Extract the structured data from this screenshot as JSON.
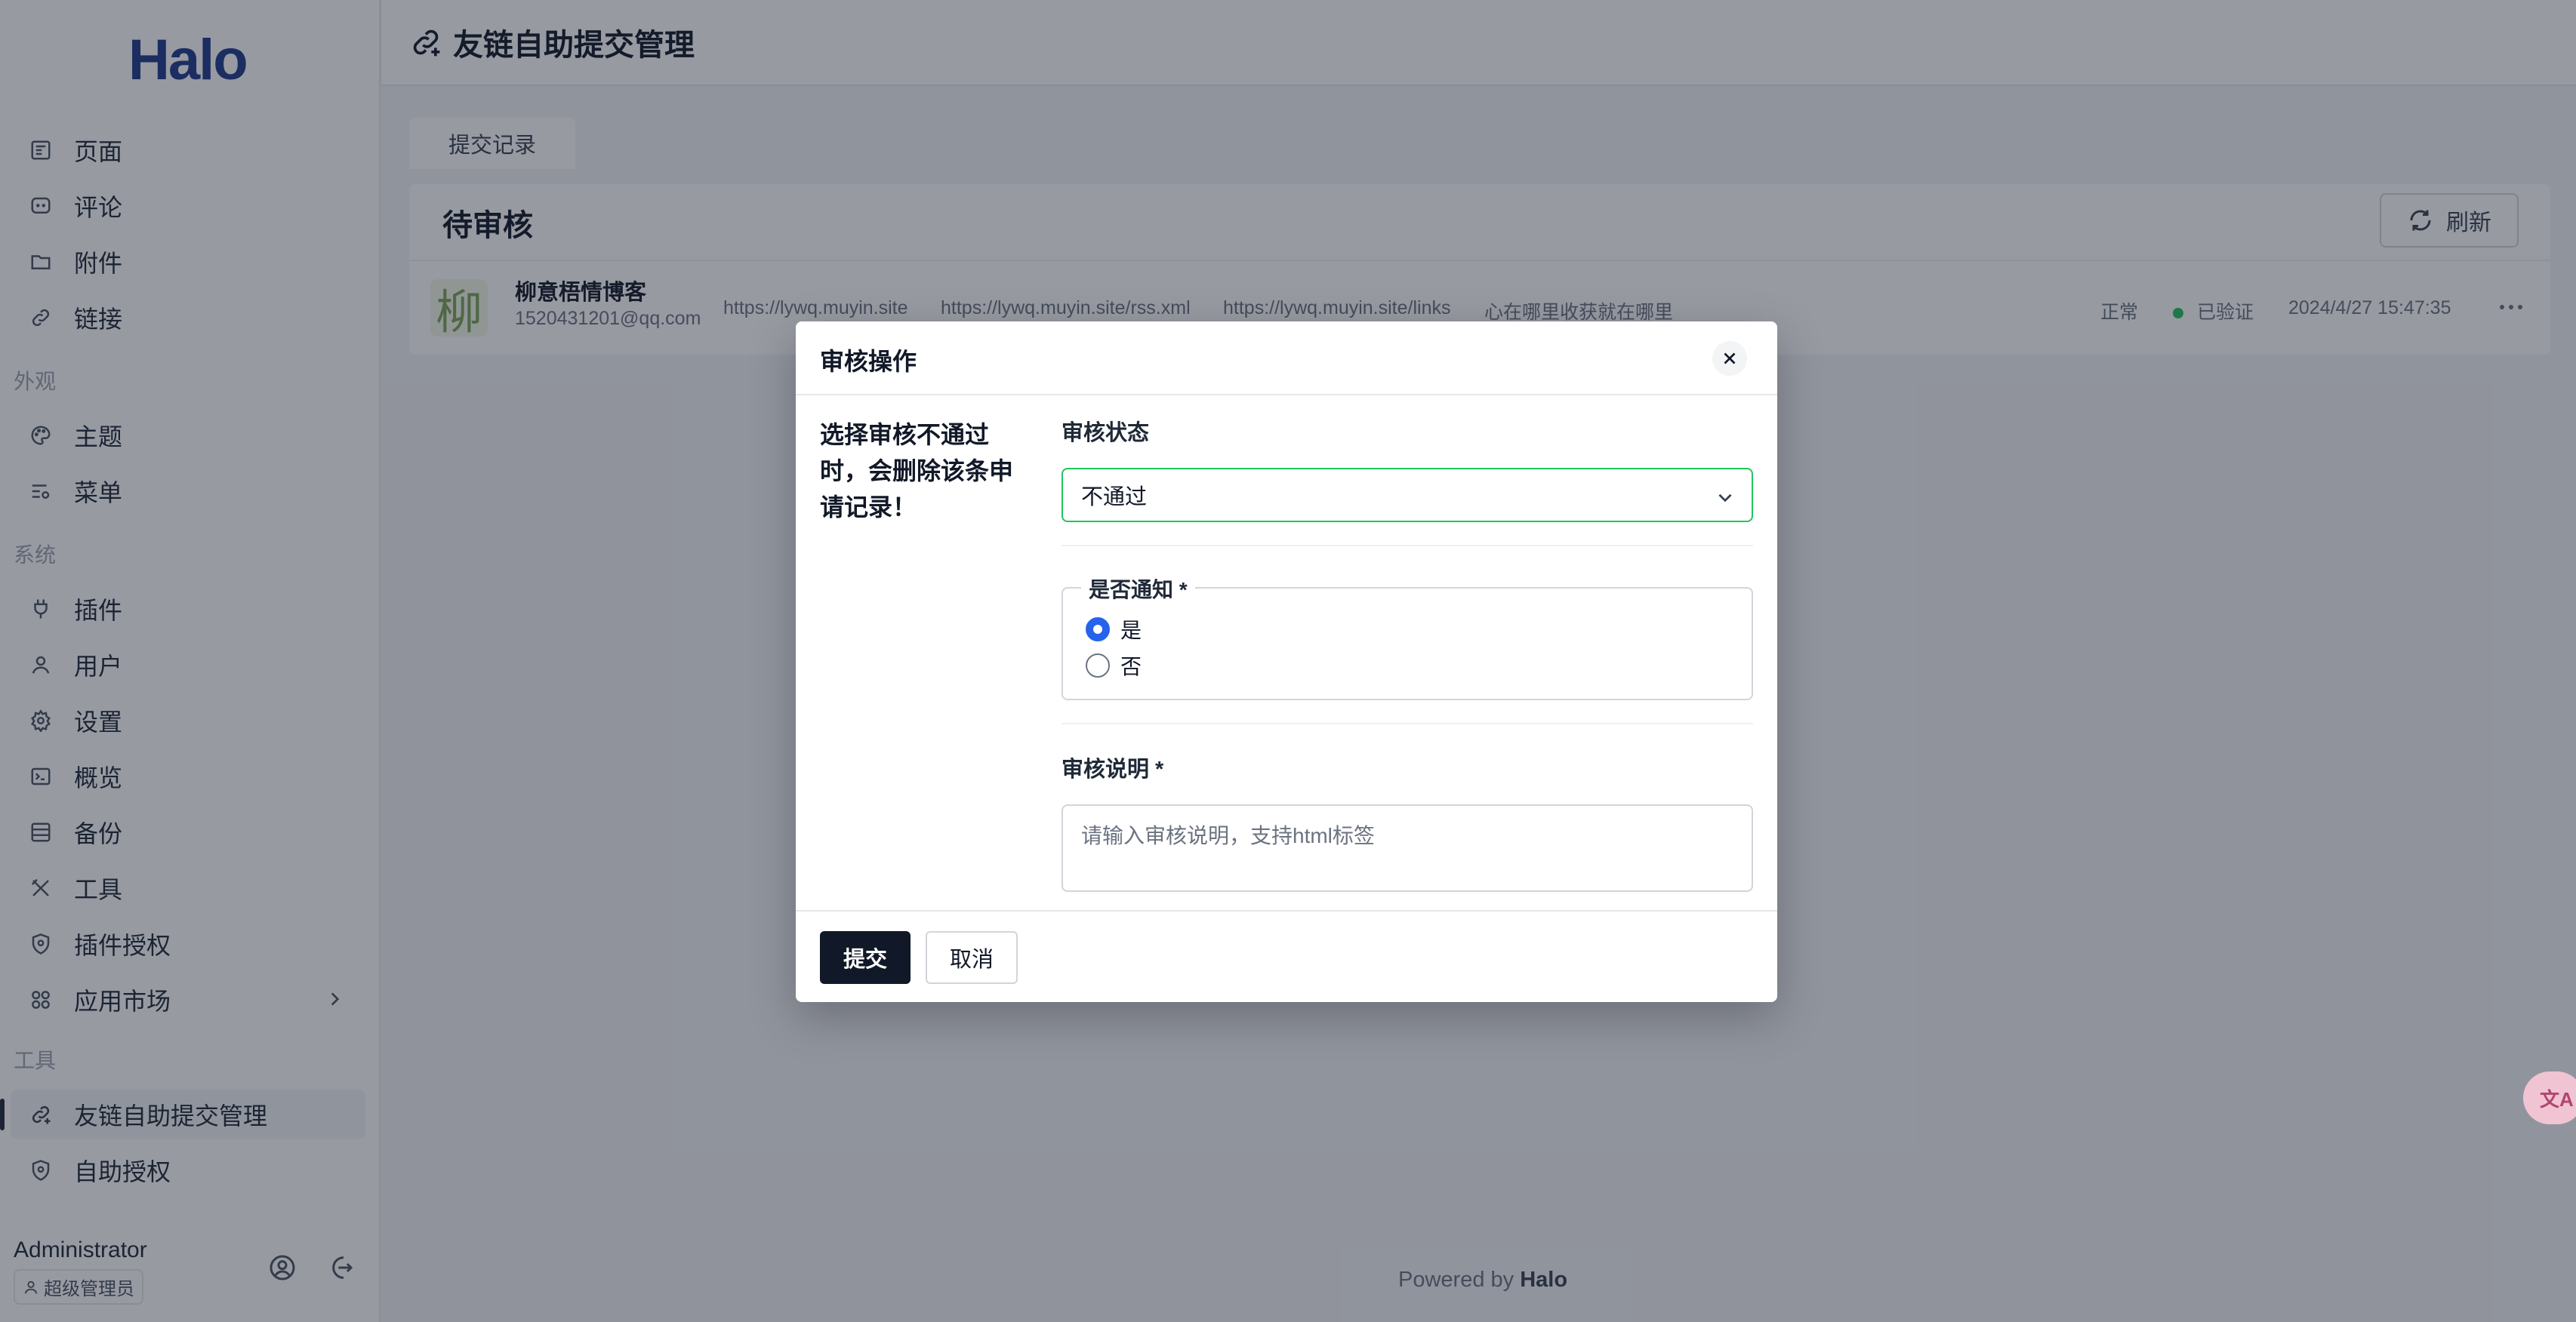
{
  "app": {
    "logo": "Halo"
  },
  "sidebar": {
    "groups": {
      "appearance": "外观",
      "system": "系统",
      "tools": "工具"
    },
    "items": [
      {
        "label": "页面",
        "icon": "page-icon"
      },
      {
        "label": "评论",
        "icon": "comment-icon"
      },
      {
        "label": "附件",
        "icon": "folder-icon"
      },
      {
        "label": "链接",
        "icon": "link-icon"
      },
      {
        "label": "主题",
        "icon": "palette-icon"
      },
      {
        "label": "菜单",
        "icon": "menu-settings-icon"
      },
      {
        "label": "插件",
        "icon": "plug-icon"
      },
      {
        "label": "用户",
        "icon": "user-icon"
      },
      {
        "label": "设置",
        "icon": "gear-icon"
      },
      {
        "label": "概览",
        "icon": "terminal-icon"
      },
      {
        "label": "备份",
        "icon": "backup-icon"
      },
      {
        "label": "工具",
        "icon": "tools-icon"
      },
      {
        "label": "插件授权",
        "icon": "shield-icon"
      },
      {
        "label": "应用市场",
        "icon": "apps-grid-icon"
      },
      {
        "label": "友链自助提交管理",
        "icon": "link-add-icon"
      },
      {
        "label": "自助授权",
        "icon": "shield-icon"
      }
    ],
    "user": {
      "name": "Administrator",
      "role": "超级管理员"
    }
  },
  "header": {
    "title": "友链自助提交管理"
  },
  "tabs": [
    {
      "label": "提交记录"
    }
  ],
  "pending": {
    "title": "待审核",
    "refresh_label": "刷新",
    "rows": [
      {
        "avatar_char": "柳",
        "name": "柳意梧情博客",
        "email": "1520431201@qq.com",
        "site_url": "https://lywq.muyin.site",
        "rss_url": "https://lywq.muyin.site/rss.xml",
        "links_url": "https://lywq.muyin.site/links",
        "description": "心在哪里收获就在哪里",
        "status": "正常",
        "verify": "已验证",
        "time": "2024/4/27 15:47:35"
      }
    ]
  },
  "footer": {
    "prefix": "Powered by",
    "brand": "Halo"
  },
  "modal": {
    "title": "审核操作",
    "warning": "选择审核不通过时，会删除该条申请记录！",
    "status_label": "审核状态",
    "status_value": "不通过",
    "notify_label": "是否通知 *",
    "notify_options": [
      {
        "label": "是",
        "checked": true
      },
      {
        "label": "否",
        "checked": false
      }
    ],
    "remark_label": "审核说明 *",
    "remark_placeholder": "请输入审核说明，支持html标签",
    "submit_label": "提交",
    "cancel_label": "取消"
  },
  "colors": {
    "accent": "#2563eb",
    "primary_button": "#111827",
    "select_border": "#22c55e",
    "verified_dot": "#22c55e"
  }
}
